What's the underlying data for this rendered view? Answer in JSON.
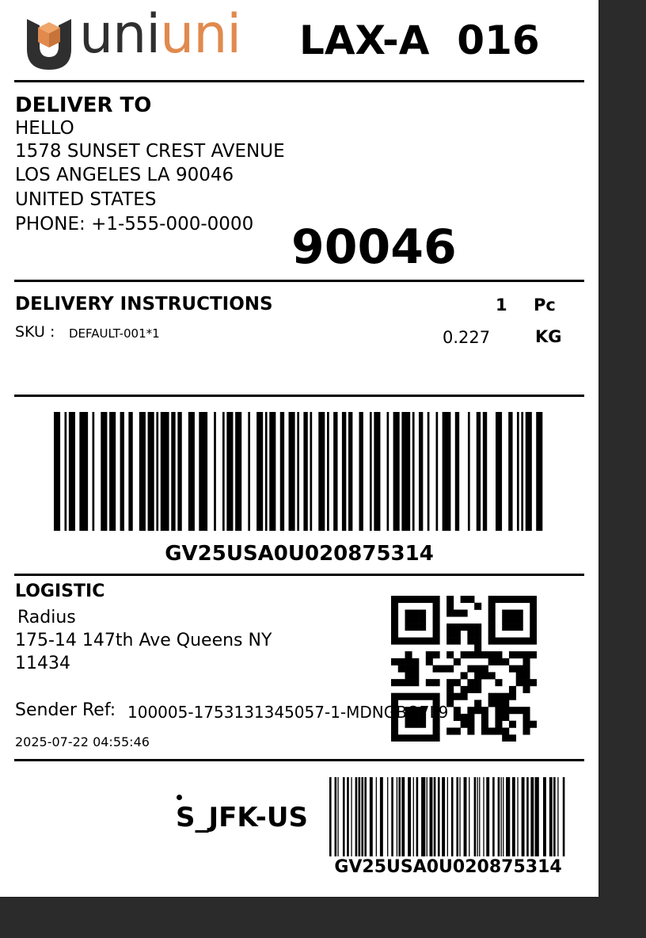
{
  "brand": {
    "logo_part1": "uni",
    "logo_part2": "uni",
    "accent_color": "#e08a4e",
    "dark_color": "#2f2f2f"
  },
  "header": {
    "route_code": "LAX-A  016"
  },
  "deliver_to": {
    "heading": "DELIVER TO",
    "lines": [
      "HELLO",
      "1578 SUNSET CREST AVENUE",
      "LOS ANGELES LA 90046",
      "UNITED STATES",
      "PHONE: +1-555-000-0000"
    ],
    "zip_large": "90046"
  },
  "delivery_instructions": {
    "heading": "DELIVERY INSTRUCTIONS",
    "sku_label": "SKU :",
    "sku_value": "DEFAULT-001*1",
    "qty": "1",
    "qty_unit": "Pc",
    "weight": "0.227",
    "weight_unit": "KG"
  },
  "barcode_main": {
    "text": "GV25USA0U020875314"
  },
  "logistic": {
    "heading": "LOGISTIC",
    "carrier": "Radius",
    "address_line1": "175-14 147th Ave Queens NY",
    "address_line2": "11434",
    "sender_ref_label": "Sender Ref:",
    "sender_ref_value": "100005-1753131345057-1-MDNGBQ7L9",
    "timestamp": "2025-07-22 04:55:46"
  },
  "footer": {
    "sort_code": "S_JFK-US",
    "barcode_text": "GV25USA0U020875314"
  }
}
